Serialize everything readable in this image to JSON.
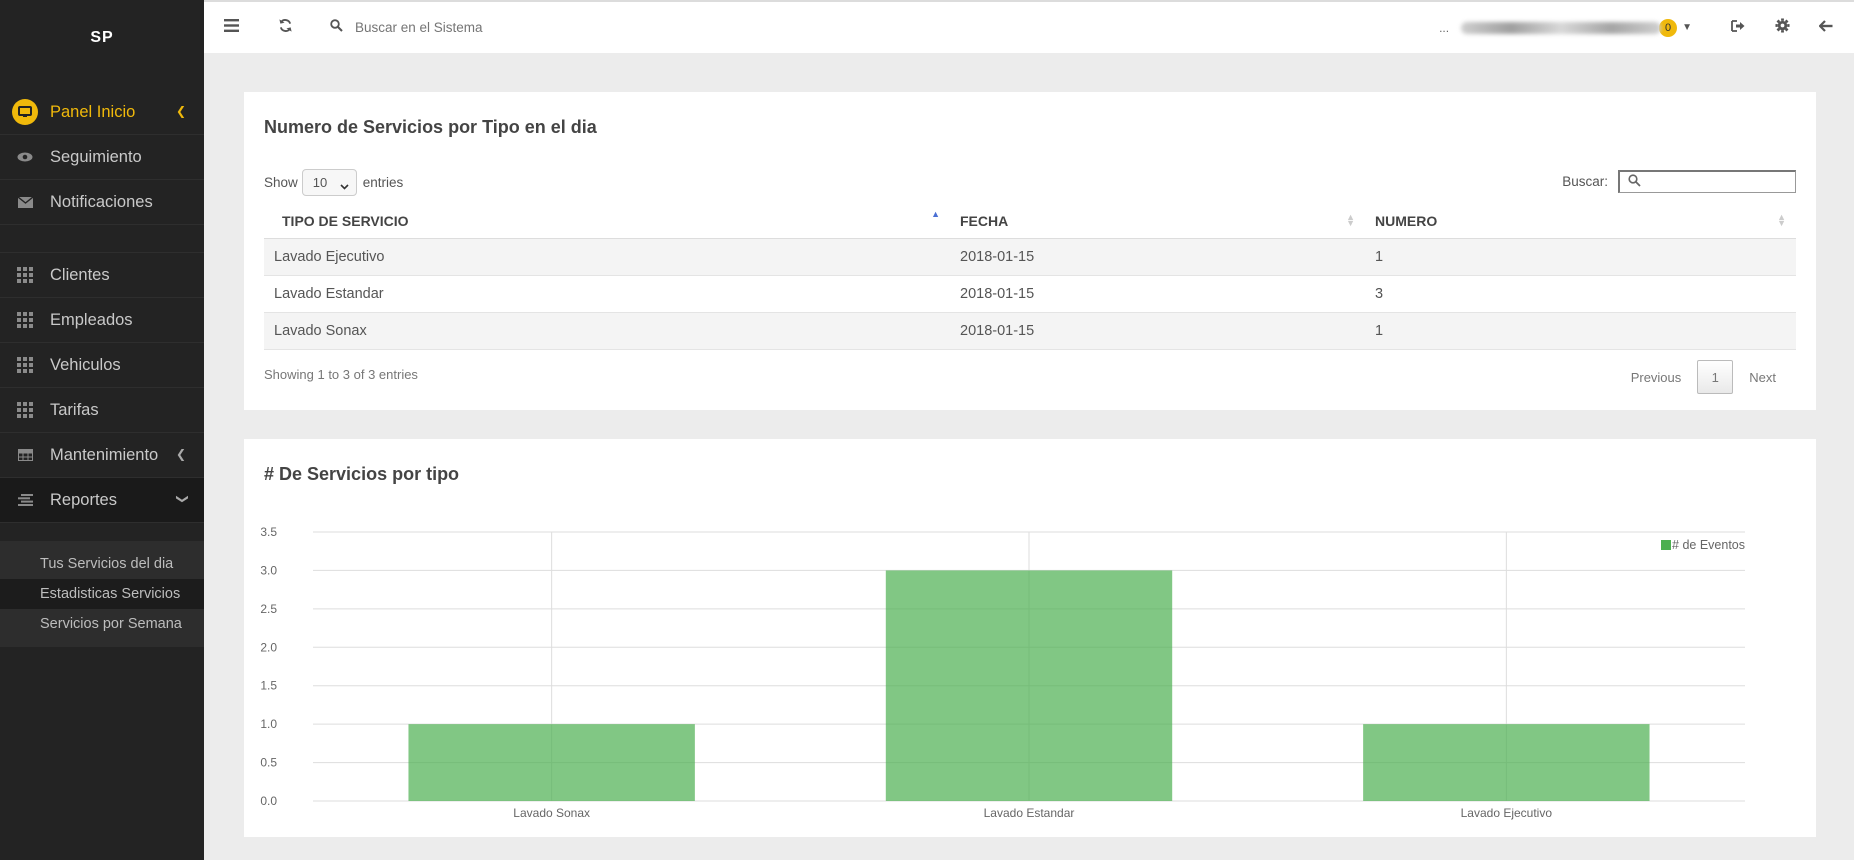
{
  "brand": "SP",
  "sidebar": {
    "items": [
      {
        "label": "Panel Inicio",
        "icon": "monitor-icon"
      },
      {
        "label": "Seguimiento",
        "icon": "eye-icon"
      },
      {
        "label": "Notificaciones",
        "icon": "envelope-icon"
      },
      {
        "label": "Clientes",
        "icon": "grid-icon"
      },
      {
        "label": "Empleados",
        "icon": "grid-icon"
      },
      {
        "label": "Vehiculos",
        "icon": "grid-icon"
      },
      {
        "label": "Tarifas",
        "icon": "grid-icon"
      },
      {
        "label": "Mantenimiento",
        "icon": "table-icon"
      },
      {
        "label": "Reportes",
        "icon": "align-left-icon"
      }
    ],
    "submenu": [
      "Tus Servicios del dia",
      "Estadisticas Servicios",
      "Servicios por Semana"
    ]
  },
  "topbar": {
    "search_placeholder": "Buscar en el Sistema",
    "user_prefix": "...",
    "notif_count": "0"
  },
  "table_panel": {
    "title": "Numero de Servicios por Tipo en el dia",
    "show_label": "Show",
    "length_value": "10",
    "entries_label": "entries",
    "search_label": "Buscar:",
    "columns": [
      "TIPO DE SERVICIO",
      "FECHA",
      "NUMERO"
    ],
    "rows": [
      [
        "Lavado Ejecutivo",
        "2018-01-15",
        "1"
      ],
      [
        "Lavado Estandar",
        "2018-01-15",
        "3"
      ],
      [
        "Lavado Sonax",
        "2018-01-15",
        "1"
      ]
    ],
    "info": "Showing 1 to 3 of 3 entries",
    "pager": {
      "previous": "Previous",
      "current": "1",
      "next": "Next"
    }
  },
  "chart_panel": {
    "title": "# De Servicios por tipo"
  },
  "chart_data": {
    "type": "bar",
    "categories": [
      "Lavado Sonax",
      "Lavado Estandar",
      "Lavado Ejecutivo"
    ],
    "series": [
      {
        "name": "# de Eventos",
        "values": [
          1,
          3,
          1
        ]
      }
    ],
    "ylim": [
      0,
      3.5
    ],
    "yticks": [
      "0.0",
      "0.5",
      "1.0",
      "1.5",
      "2.0",
      "2.5",
      "3.0",
      "3.5"
    ],
    "grid": true,
    "legend_position": "top-right",
    "color": "#4caf50"
  }
}
